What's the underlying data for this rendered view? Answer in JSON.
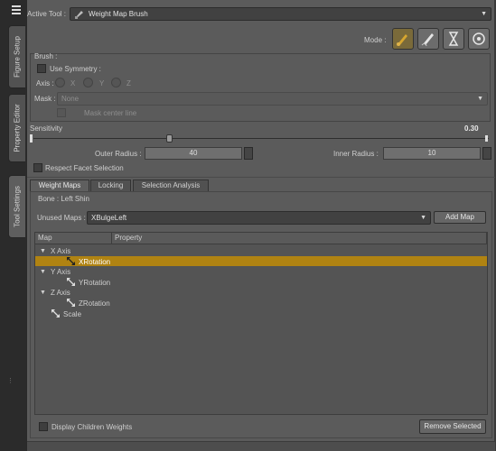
{
  "sidebar": {
    "tabs": [
      {
        "label": "Figure Setup"
      },
      {
        "label": "Property Editor"
      },
      {
        "label": "Tool Settings"
      }
    ]
  },
  "toolbar": {
    "active_tool_label": "Active Tool :",
    "active_tool_value": "Weight Map Brush"
  },
  "mode": {
    "label": "Mode :"
  },
  "brush": {
    "group_label": "Brush :",
    "use_symmetry": "Use Symmetry :",
    "axis_label": "Axis :",
    "axes": [
      "X",
      "Y",
      "Z"
    ],
    "mask_label": "Mask :",
    "mask_value": "None",
    "mask_center_line": "Mask center line"
  },
  "sensitivity": {
    "label": "Sensitivity",
    "value": "0.30",
    "level": 0.3
  },
  "radius": {
    "outer_label": "Outer Radius :",
    "outer_value": "40",
    "inner_label": "Inner Radius :",
    "inner_value": "10"
  },
  "respect_facet": "Respect Facet Selection",
  "tabs": [
    {
      "label": "Weight Maps"
    },
    {
      "label": "Locking"
    },
    {
      "label": "Selection Analysis"
    }
  ],
  "bone_label": "Bone : Left Shin",
  "unused_maps": {
    "label": "Unused Maps :",
    "value": "XBulgeLeft",
    "add_button": "Add Map"
  },
  "tree": {
    "columns": [
      "Map",
      "Property"
    ],
    "rows": [
      {
        "label": "X Axis"
      },
      {
        "label": "XRotation"
      },
      {
        "label": "Y Axis"
      },
      {
        "label": "YRotation"
      },
      {
        "label": "Z Axis"
      },
      {
        "label": "ZRotation"
      },
      {
        "label": "Scale"
      }
    ]
  },
  "footer": {
    "display_children": "Display Children Weights",
    "remove_selected": "Remove Selected"
  },
  "colors": {
    "selection": "#b08312",
    "panel": "#5b5b5b",
    "mode_active": "#c79a2a"
  }
}
